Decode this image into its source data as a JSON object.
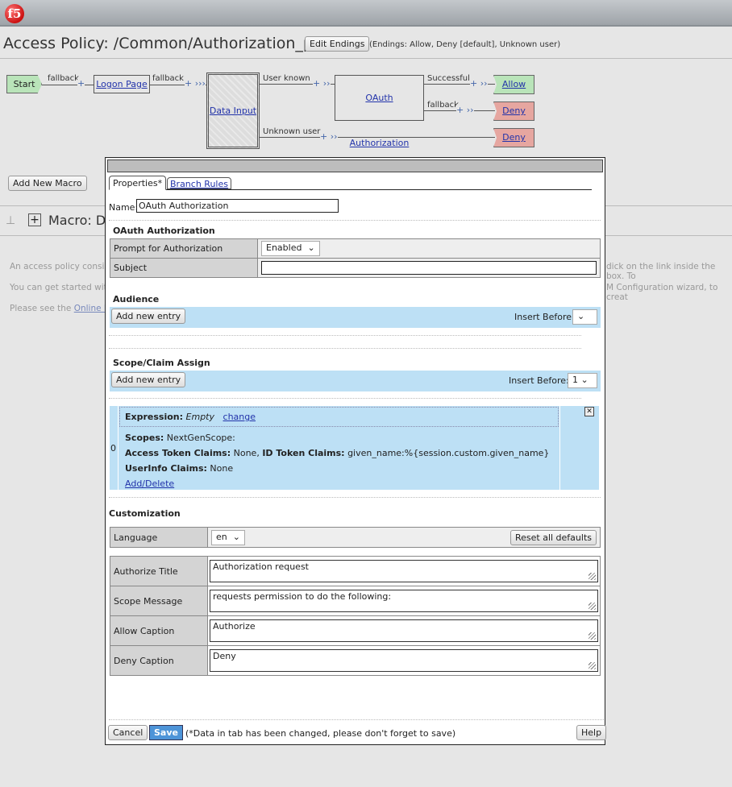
{
  "header": {
    "logo": "f5",
    "title": "Access Policy: /Common/Authorization_policy",
    "edit_endings": "Edit Endings",
    "endings_info": "(Endings: Allow, Deny [default], Unknown user)"
  },
  "flow": {
    "start": "Start",
    "fallback1": "fallback",
    "logon": "Logon Page",
    "fallback2": "fallback",
    "data_input": "Data Input",
    "user_known": "User known",
    "unknown_user": "Unknown user",
    "oauth": "OAuth Authorization",
    "successful": "Successful",
    "fallback3": "fallback",
    "allow": "Allow",
    "deny1": "Deny",
    "deny2": "Deny",
    "colors": {
      "start": "#b9e4b9",
      "allow": "#b9e4b9",
      "deny": "#e6a6a0"
    }
  },
  "background": {
    "add_macro": "Add New Macro",
    "macro_title": "Macro: D",
    "line1a": "An access policy consists",
    "line1b": "dick on the link inside the box. To",
    "line2a": "You can get started with",
    "line2b": "M Configuration wizard, to creat",
    "line3a": "Please see the ",
    "line3_link": "Online He"
  },
  "dialog": {
    "tabs": [
      "Properties*",
      "Branch Rules"
    ],
    "name_label": "Name:",
    "name_value": "OAuth Authorization",
    "section_title": "OAuth Authorization",
    "prompt_label": "Prompt for Authorization",
    "prompt_value": "Enabled",
    "subject_label": "Subject",
    "subject_value": "",
    "audience": {
      "title": "Audience",
      "add": "Add new entry",
      "insert_before": "Insert Before:",
      "insert_value": ""
    },
    "scope": {
      "title": "Scope/Claim Assign",
      "add": "Add new entry",
      "insert_before": "Insert Before:",
      "insert_value": "1"
    },
    "entry": {
      "index": "0",
      "expr_label": "Expression:",
      "expr_value": "Empty",
      "change": "change",
      "scopes_label": "Scopes:",
      "scopes_value": "NextGenScope:",
      "atc_label": "Access Token Claims:",
      "atc_value": "None,",
      "idc_label": "ID Token Claims:",
      "idc_value": "given_name:%{session.custom.given_name}",
      "uic_label": "UserInfo Claims:",
      "uic_value": "None",
      "add_delete": "Add/Delete"
    },
    "customization": {
      "title": "Customization",
      "language_label": "Language",
      "language_value": "en",
      "reset": "Reset all defaults",
      "fields": [
        {
          "label": "Authorize Title",
          "value": "Authorization request"
        },
        {
          "label": "Scope Message",
          "value": "requests permission to do the following:"
        },
        {
          "label": "Allow Caption",
          "value": "Authorize"
        },
        {
          "label": "Deny Caption",
          "value": "Deny"
        }
      ]
    },
    "footer": {
      "cancel": "Cancel",
      "save": "Save",
      "note": "(*Data in tab has been changed, please don't forget to save)",
      "help": "Help"
    }
  }
}
